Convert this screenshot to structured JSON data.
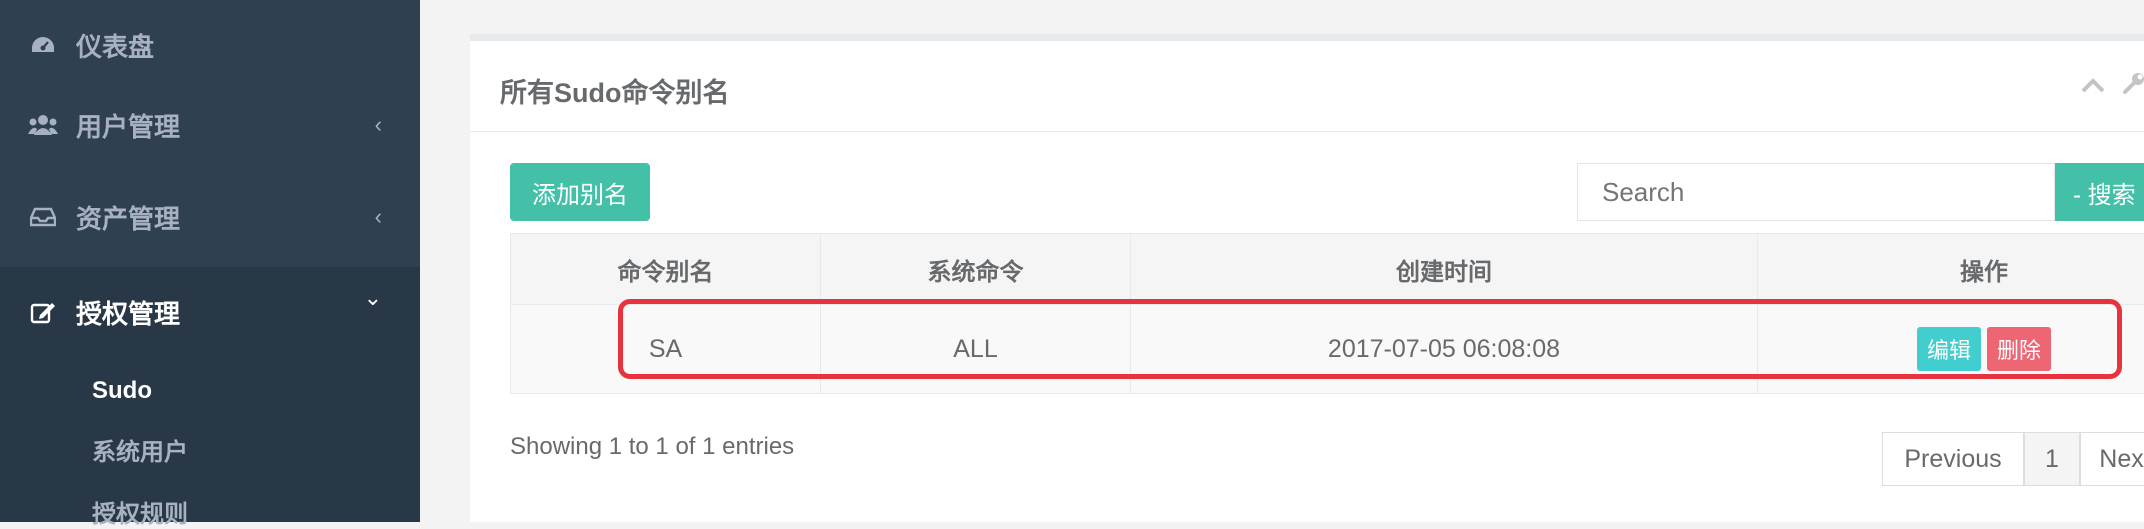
{
  "sidebar": {
    "items": [
      {
        "label": "仪表盘",
        "icon": "dashboard-icon",
        "arrow": ""
      },
      {
        "label": "用户管理",
        "icon": "users-icon",
        "arrow": "‹"
      },
      {
        "label": "资产管理",
        "icon": "inbox-icon",
        "arrow": "‹"
      },
      {
        "label": "授权管理",
        "icon": "edit-icon",
        "arrow": "⌄"
      }
    ],
    "subitems": [
      {
        "label": "Sudo"
      },
      {
        "label": "系统用户"
      },
      {
        "label": "授权规则"
      }
    ]
  },
  "panel": {
    "title": "所有Sudo命令别名",
    "collapse_icon": "chevron-up-icon",
    "wrench_icon": "wrench-icon"
  },
  "toolbar": {
    "add_label": "添加别名",
    "search_placeholder": "Search",
    "search_button_label": "- 搜索"
  },
  "table": {
    "columns": [
      "命令别名",
      "系统命令",
      "创建时间",
      "操作"
    ],
    "rows": [
      {
        "alias": "SA",
        "command": "ALL",
        "created": "2017-07-05 06:08:08",
        "edit_label": "编辑",
        "delete_label": "删除"
      }
    ]
  },
  "footer": {
    "info": "Showing 1 to 1 of 1 entries",
    "previous_label": "Previous",
    "page": "1",
    "next_label": "Next"
  },
  "colors": {
    "sidebar_bg": "#2f4050",
    "primary": "#1ab394",
    "info": "#23c6c8",
    "danger": "#ed5565",
    "highlight": "#e8333f"
  }
}
